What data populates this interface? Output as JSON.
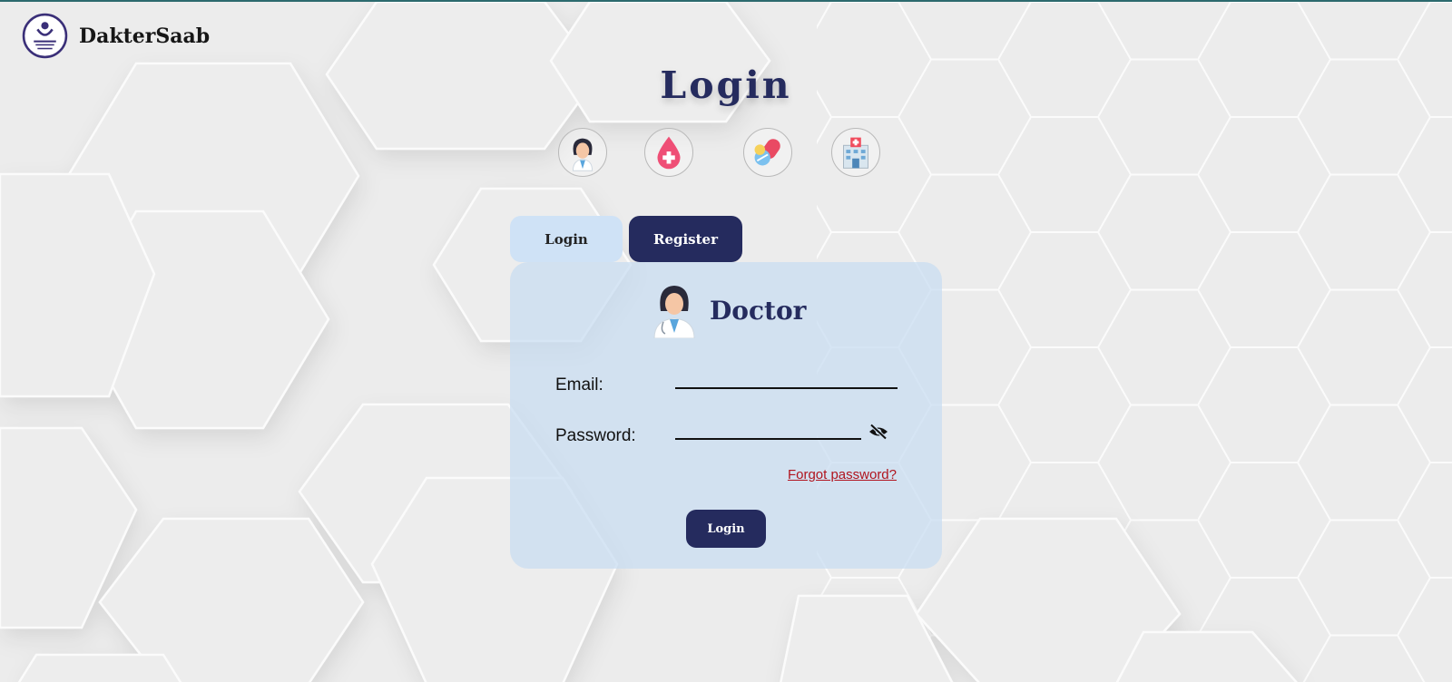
{
  "brand": {
    "name": "DakterSaab",
    "logo_icon": "heart-hands-logo-icon"
  },
  "page": {
    "title": "Login"
  },
  "roles": [
    {
      "name": "doctor",
      "icon": "doctor-icon"
    },
    {
      "name": "blood-donor",
      "icon": "blood-drop-icon"
    },
    {
      "name": "pharmacy",
      "icon": "pills-icon"
    },
    {
      "name": "hospital",
      "icon": "hospital-icon"
    }
  ],
  "tabs": {
    "login": "Login",
    "register": "Register"
  },
  "form": {
    "role_title": "Doctor",
    "email_label": "Email:",
    "email_value": "",
    "password_label": "Password:",
    "password_value": "",
    "password_toggle_icon": "eye-slash-icon",
    "forgot_link": "Forgot password?",
    "submit_label": "Login"
  },
  "colors": {
    "primary": "#252b5e",
    "tab_inactive": "#cfe2f6",
    "card_bg": "#c7dcf1",
    "link": "#b0141e",
    "background": "#ececec"
  }
}
